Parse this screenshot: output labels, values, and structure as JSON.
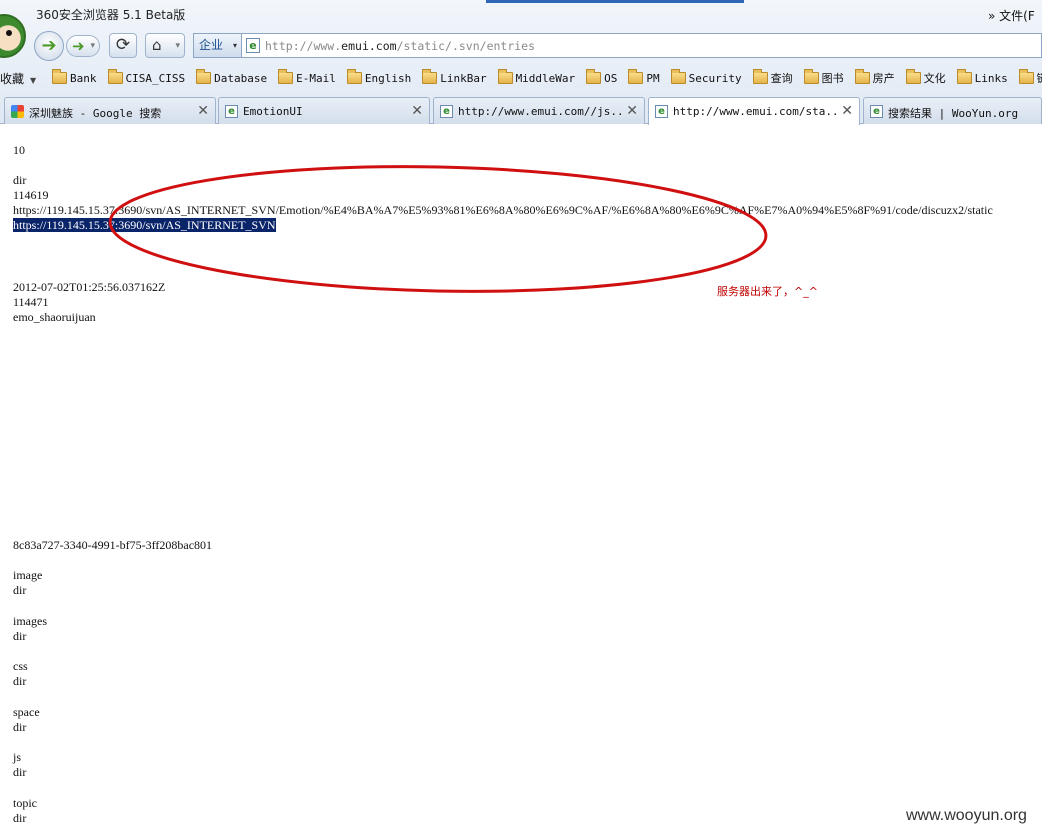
{
  "window": {
    "title": "360安全浏览器 5.1 Beta版",
    "file_menu": "» 文件(F"
  },
  "toolbar": {
    "back_icon": "back-arrow-icon",
    "forward_icon": "forward-arrow-icon",
    "refresh_icon": "refresh-icon",
    "home_icon": "home-icon",
    "mode_label": "企业",
    "address_prefix": "http://www.",
    "address_host": "emui.com",
    "address_path": "/static/.svn/entries"
  },
  "bookmarks": {
    "first_label": "收藏",
    "items": [
      {
        "label": "Bank"
      },
      {
        "label": "CISA_CISS"
      },
      {
        "label": "Database"
      },
      {
        "label": "E-Mail"
      },
      {
        "label": "English"
      },
      {
        "label": "LinkBar"
      },
      {
        "label": "MiddleWar"
      },
      {
        "label": "OS"
      },
      {
        "label": "PM"
      },
      {
        "label": "Security"
      },
      {
        "label": "查询"
      },
      {
        "label": "图书"
      },
      {
        "label": "房产"
      },
      {
        "label": "文化"
      },
      {
        "label": "Links"
      },
      {
        "label": "链接"
      }
    ]
  },
  "tabs": [
    {
      "label": "深圳魅族 - Google 搜索",
      "icon": "google-icon",
      "active": false
    },
    {
      "label": "EmotionUI",
      "icon": "page-e-icon",
      "active": false
    },
    {
      "label": "http://www.emui.com//js...",
      "icon": "page-e-icon",
      "active": false
    },
    {
      "label": "http://www.emui.com/sta...",
      "icon": "page-e-icon",
      "active": true
    },
    {
      "label": "搜索结果 | WooYun.org",
      "icon": "page-e-icon",
      "active": false
    }
  ],
  "content": {
    "line_version": "10",
    "line_kind": "dir",
    "line_revision": "114619",
    "line_url": "https://119.145.15.37:3690/svn/AS_INTERNET_SVN/Emotion/%E4%BA%A7%E5%93%81%E6%8A%80%E6%9C%AF/%E6%8A%80%E6%9C%AF%E7%A0%94%E5%8F%91/code/discuzx2/static",
    "line_repo": "https://119.145.15.37:3690/svn/AS_INTERNET_SVN",
    "line_date": "2012-07-02T01:25:56.037162Z",
    "line_commit_rev": "114471",
    "line_author": "emo_shaoruijuan",
    "line_uuid": "8c83a727-3340-4991-bf75-3ff208bac801",
    "entries": [
      {
        "name": "image",
        "kind": "dir"
      },
      {
        "name": "images",
        "kind": "dir"
      },
      {
        "name": "css",
        "kind": "dir"
      },
      {
        "name": "space",
        "kind": "dir"
      },
      {
        "name": "js",
        "kind": "dir"
      },
      {
        "name": "topic",
        "kind": "dir"
      }
    ],
    "annotation": "服务器出来了，^_^",
    "watermark": "www.wooyun.org"
  },
  "colors": {
    "selection": "#0a246a",
    "annotation_red": "#c00000",
    "ellipse_red": "#d01010"
  }
}
